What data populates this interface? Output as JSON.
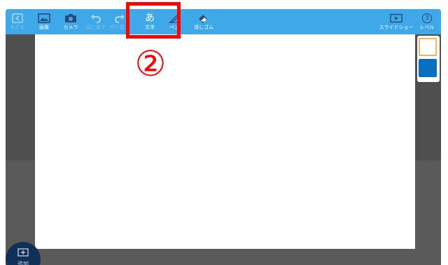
{
  "toolbar": {
    "undo_label": "もどる",
    "image_label": "画像",
    "camera_label": "カメラ",
    "redo_back_label": "元に戻す",
    "redo_label": "やり直す",
    "text_label": "文字",
    "pen_label": "ペン",
    "eraser_label": "消しゴム",
    "slideshow_label": "スライドショー",
    "level_label": "レベル",
    "level_number": "3"
  },
  "text_icon_glyph": "あ",
  "palette": {
    "colors": [
      "#ffffff",
      "#0b6fbf"
    ],
    "selected_border": "#f1b35c"
  },
  "add": {
    "label": "追加"
  },
  "annotation": {
    "marker": "②",
    "color": "#ff0000"
  },
  "colors": {
    "toolbar": "#3ea8e8",
    "workspace": "#5a5a5a",
    "add_button": "#103057"
  }
}
